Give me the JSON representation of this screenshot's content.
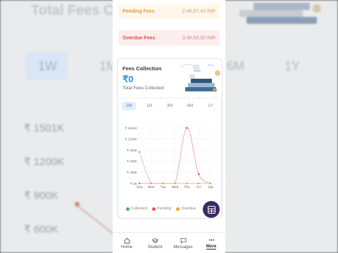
{
  "background": {
    "title": "Total Fees Co",
    "ranges": [
      "1W",
      "1M",
      "6M",
      "1Y"
    ],
    "y_ticks": [
      "₹ 1501K",
      "₹ 1200K",
      "₹ 900K",
      "₹ 600K"
    ]
  },
  "stats": {
    "pending": {
      "label": "Pending Fees",
      "value": "2,46,87,42 INR"
    },
    "overdue": {
      "label": "Overdue Fees",
      "value": "3,46,50,00 INR"
    }
  },
  "card": {
    "title": "Fees Collection",
    "amount": "₹0",
    "subtitle": "Total Fees Collected"
  },
  "ranges": {
    "selected": "1W",
    "items": [
      "1W",
      "1M",
      "3M",
      "6M",
      "1Y"
    ]
  },
  "chart_data": {
    "type": "line",
    "categories": [
      "Sun",
      "Mon",
      "Tue",
      "Wed",
      "Thu",
      "Fri",
      "Sat"
    ],
    "y_ticks": [
      {
        "value": 0,
        "label": "₹ 0K"
      },
      {
        "value": 300,
        "label": "₹ 300K"
      },
      {
        "value": 600,
        "label": "₹ 600K"
      },
      {
        "value": 900,
        "label": "₹ 900K"
      },
      {
        "value": 1200,
        "label": "₹ 1200K"
      },
      {
        "value": 1501,
        "label": "₹ 1501K"
      }
    ],
    "ylim": [
      0,
      1501
    ],
    "series": [
      {
        "name": "Collected",
        "color": "#4caf50",
        "values": [
          0,
          0,
          0,
          0,
          0,
          0,
          0
        ],
        "line": false
      },
      {
        "name": "Pending",
        "color": "#e0544e",
        "values": [
          0,
          0,
          0,
          0,
          1501,
          250,
          0
        ],
        "line": true
      },
      {
        "name": "Overdue",
        "color": "#e8a13b",
        "values": [
          850,
          0,
          0,
          0,
          0,
          0,
          0
        ],
        "line": false
      }
    ],
    "grid": true,
    "legend": "bottom"
  },
  "nav": {
    "items": [
      {
        "label": "Home",
        "icon": "home-icon"
      },
      {
        "label": "Student",
        "icon": "student-icon"
      },
      {
        "label": "Messages",
        "icon": "messages-icon"
      },
      {
        "label": "More",
        "icon": "more-icon"
      }
    ],
    "active": "More"
  },
  "colors": {
    "accent": "#2a8fd0",
    "pending": "#e0544e",
    "overdue": "#e8a13b",
    "fab": "#3b2b63"
  }
}
